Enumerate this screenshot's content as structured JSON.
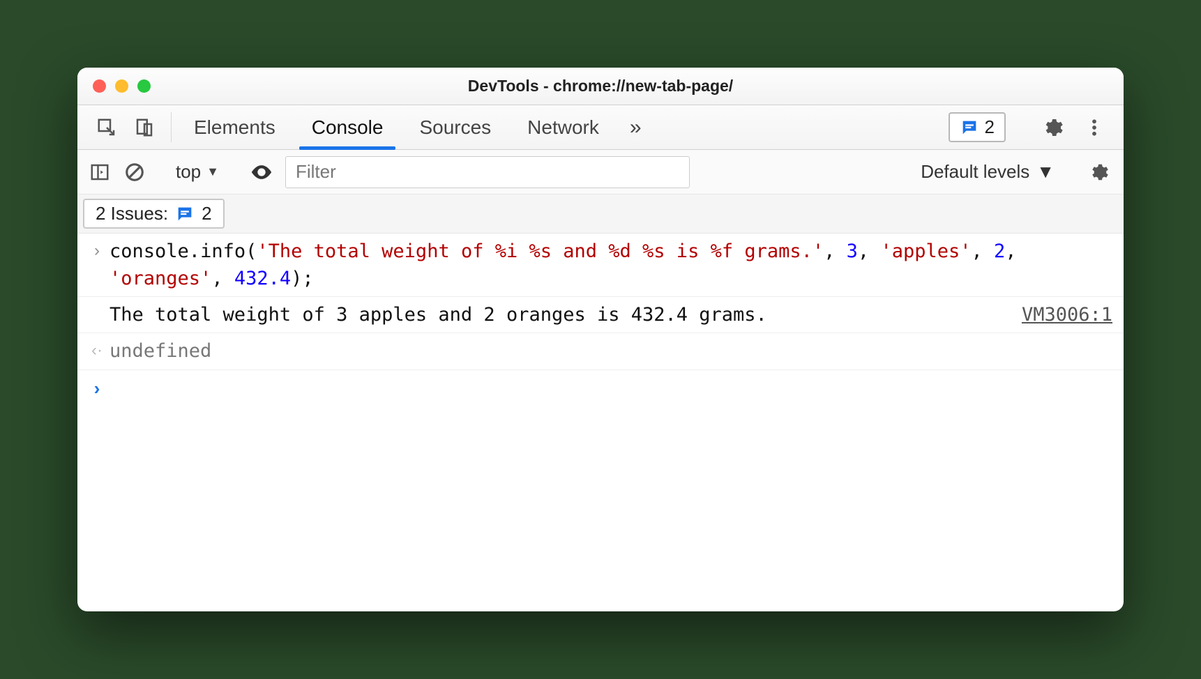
{
  "window": {
    "title": "DevTools - chrome://new-tab-page/"
  },
  "tabstrip": {
    "tabs": [
      "Elements",
      "Console",
      "Sources",
      "Network"
    ],
    "selected_index": 1,
    "more_glyph": "»",
    "issues_count": "2"
  },
  "console_toolbar": {
    "context": "top",
    "filter_placeholder": "Filter",
    "levels": "Default levels"
  },
  "issues_row": {
    "label": "2 Issues:",
    "count": "2"
  },
  "console": {
    "input_code": {
      "segments": [
        {
          "t": "console",
          "c": "tok-obj"
        },
        {
          "t": ".",
          "c": "tok-pun"
        },
        {
          "t": "info",
          "c": "tok-fn"
        },
        {
          "t": "(",
          "c": "tok-pun"
        },
        {
          "t": "'The total weight of %i %s and %d %s is %f grams.'",
          "c": "tok-str"
        },
        {
          "t": ", ",
          "c": "tok-pun"
        },
        {
          "t": "3",
          "c": "tok-num"
        },
        {
          "t": ", ",
          "c": "tok-pun"
        },
        {
          "t": "'apples'",
          "c": "tok-str"
        },
        {
          "t": ", ",
          "c": "tok-pun"
        },
        {
          "t": "2",
          "c": "tok-num"
        },
        {
          "t": ", ",
          "c": "tok-pun"
        },
        {
          "t": "'oranges'",
          "c": "tok-str"
        },
        {
          "t": ", ",
          "c": "tok-pun"
        },
        {
          "t": "432.4",
          "c": "tok-num"
        },
        {
          "t": ");",
          "c": "tok-pun"
        }
      ]
    },
    "output_text": "The total weight of 3 apples and 2 oranges is 432.4 grams.",
    "output_source": "VM3006:1",
    "return_value": "undefined",
    "prompt_glyph": "›",
    "input_glyph": "›",
    "return_glyph": "‹·"
  }
}
